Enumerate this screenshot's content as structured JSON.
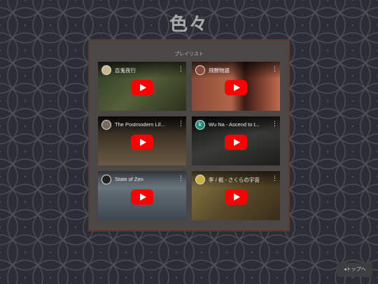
{
  "site": {
    "title": "色々"
  },
  "playlist": {
    "heading": "プレイリスト",
    "videos": [
      {
        "title": "百鬼夜行",
        "avatar_letter": "",
        "avatar_color": "#c9b68a",
        "thumb": "#3a4a2e"
      },
      {
        "title": "飛騨物語",
        "avatar_letter": "",
        "avatar_color": "#8a4a3a",
        "thumb": "#5a2e24"
      },
      {
        "title": "The Postmodern Lif...",
        "avatar_letter": "",
        "avatar_color": "#7a6a5a",
        "thumb": "#3a3226"
      },
      {
        "title": "Wu Na - Ascend to t...",
        "avatar_letter": "k",
        "avatar_color": "#1f8a7a",
        "thumb": "#2a2a2a"
      },
      {
        "title": "State of Zen",
        "avatar_letter": "",
        "avatar_color": "#222222",
        "thumb": "#4e5a62"
      },
      {
        "title": "李 / 祖 - さくらの宇宙",
        "avatar_letter": "",
        "avatar_color": "#c9b040",
        "thumb": "#5a4a2a"
      }
    ]
  },
  "footer": {
    "back_to_top": "◂トップへ"
  }
}
